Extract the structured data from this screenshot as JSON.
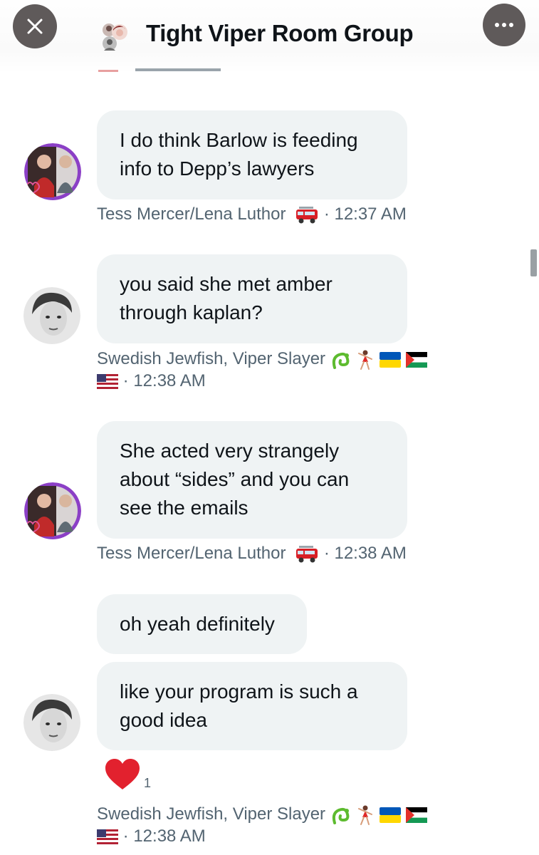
{
  "header": {
    "title": "Tight Viper Room Group",
    "close_icon": "close-icon",
    "more_icon": "more-icon"
  },
  "messages": [
    {
      "lines": [
        "I do think Barlow is feeding",
        "info to Depp’s lawyers"
      ],
      "sender": "Tess Mercer/Lena Luthor",
      "time": "· 12:37 AM"
    },
    {
      "lines": [
        "you said she met amber",
        "through kaplan?"
      ],
      "sender": "Swedish Jewfish, Viper Slayer",
      "time": "· 12:38 AM"
    },
    {
      "lines": [
        "She acted very strangely",
        "about “sides” and you can",
        "see the emails"
      ],
      "sender": "Tess Mercer/Lena Luthor",
      "time": "· 12:38 AM"
    },
    {
      "lines": [
        "oh yeah definitely"
      ]
    },
    {
      "lines": [
        "like your program is such a",
        "good idea"
      ],
      "reaction_count": "1",
      "sender": "Swedish Jewfish, Viper Slayer",
      "time": "· 12:38 AM"
    }
  ],
  "colors": {
    "bubble": "#eff3f4",
    "meta_text": "#536471",
    "heart": "#f4212e"
  }
}
